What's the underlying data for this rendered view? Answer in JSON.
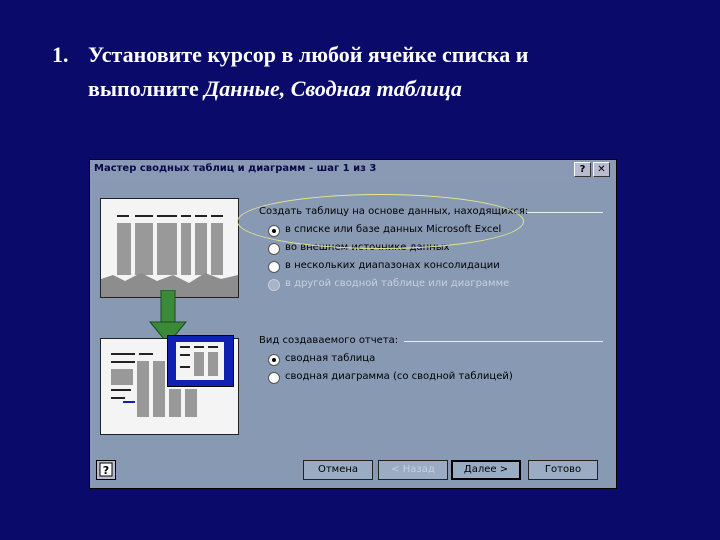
{
  "slide": {
    "number": "1.",
    "line1": "Установите курсор в любой ячейке списка и",
    "line2_prefix": "выполните ",
    "line2_italic": "Данные, Сводная таблица"
  },
  "dialog": {
    "title": "Мастер сводных таблиц и диаграмм - шаг 1 из 3",
    "help_button": "?",
    "close_button": "✕",
    "source_group": {
      "title": "Создать таблицу на основе данных, находящихся:",
      "options": [
        {
          "label": "в списке или базе данных Microsoft Excel",
          "selected": true,
          "enabled": true
        },
        {
          "label": "во внешнем источнике данных",
          "selected": false,
          "enabled": true
        },
        {
          "label": "в нескольких диапазонах консолидации",
          "selected": false,
          "enabled": true
        },
        {
          "label": "в другой сводной таблице или диаграмме",
          "selected": false,
          "enabled": false
        }
      ]
    },
    "report_group": {
      "title": "Вид создаваемого отчета:",
      "options": [
        {
          "label": "сводная таблица",
          "selected": true,
          "enabled": true
        },
        {
          "label": "сводная диаграмма (со сводной таблицей)",
          "selected": false,
          "enabled": true
        }
      ]
    },
    "buttons": {
      "cancel": "Отмена",
      "back": "< Назад",
      "next": "Далее >",
      "finish": "Готово"
    },
    "colors": {
      "slide_background": "#0a0a6b",
      "dialog_background": "#8899b3",
      "highlight_ellipse": "#e8e88a",
      "arrow_green": "#3a8a3a",
      "pivot_frame_blue": "#1020b0"
    }
  }
}
